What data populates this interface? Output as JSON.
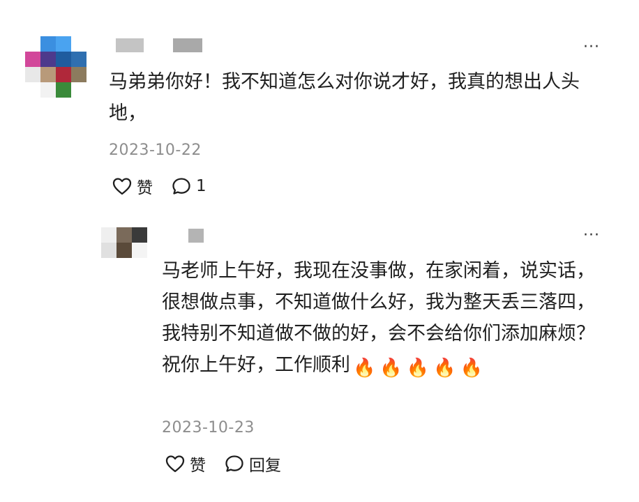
{
  "comments": [
    {
      "text": "马弟弟你好！我不知道怎么对你说才好，我真的想出人头地，",
      "date": "2023-10-22",
      "like_label": "赞",
      "reply_count": "1",
      "more": "···"
    }
  ],
  "reply": {
    "text": "马老师上午好，我现在没事做，在家闲着，说实话，很想做点事，不知道做什么好，我为整天丢三落四，我特别不知道做不做的好，会不会给你们添加麻烦？祝你上午好，工作顺利",
    "emoji": "🔥🔥🔥🔥🔥",
    "date": "2023-10-23",
    "like_label": "赞",
    "reply_label": "回复",
    "more": "···"
  }
}
